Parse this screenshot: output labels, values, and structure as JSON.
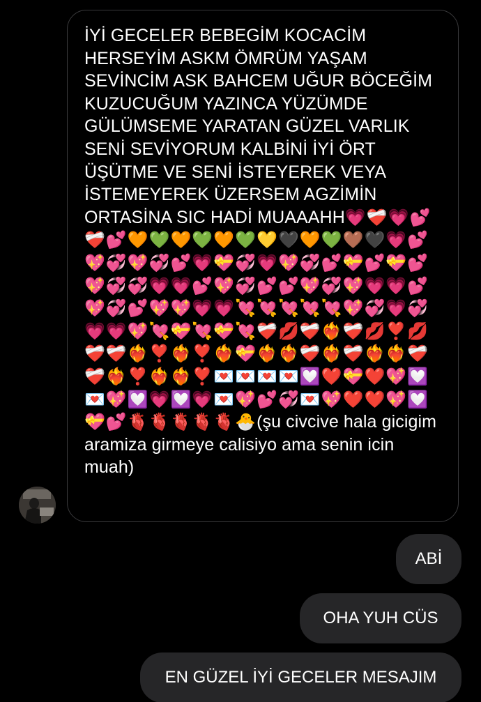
{
  "incoming_message": {
    "text_main": "İYİ GECELER BEBEGİM KOCACİM HERSEYİM ASKM ÖMRÜM YAŞAM SEVİNCİM ASK BAHCEM UĞUR BÖCEĞİM KUZUCUĞUM YAZINCA YÜZÜMDE GÜLÜMSEME YARATAN GÜZEL VARLIK SENİ SEVİYORUM KALBİNİ İYİ ÖRT ÜŞÜTME VE SENİ İSTEYEREK VEYA İSTEMEYEREK ÜZERSEM AGZİMİN ORTASİNA SIC HADİ MUAAAHH",
    "emojis": "💗❤️‍🩹💗💕❤️‍🩹💕🧡💚🧡💚🧡💚💛🖤🧡💚🤎🖤💗💕💖💞💖💞💕💗💝💞💗💖💞💕💝💕💝💕💖💞💞💗💗💕💖💞💕💕💖💞💖💗💗💕💖💞💕💖💖💗💗💘💘💘💘💘💖💞💗💞💗💗💖💘💝💘💝💘❤️‍🩹💋❤️‍🩹❤️‍🔥❤️‍🩹💋❣️💋❤️‍🩹❤️‍🩹❤️‍🔥❣️❤️‍🔥❣️❤️‍🔥💝❤️‍🔥❤️‍🔥❤️‍🩹❤️‍🔥❤️‍🩹❤️‍🔥❤️‍🔥❤️‍🩹❤️‍🩹❤️‍🔥❣️❤️‍🔥❤️‍🔥❣️💌💌💌💌💟❤️💝❤️💖💟💌💖💟💗💟💗💌💖💕💞💌💖❤️❤️💖💟💝💕🫀🫀🫀🫀🫀🐣",
    "text_tail": "(şu civcive hala gicigim aramiza girmeye calisiyo ama senin icin muah)"
  },
  "outgoing_messages": [
    {
      "text": "ABİ"
    },
    {
      "text": "OHA YUH CÜS"
    },
    {
      "text": "EN GÜZEL İYİ GECELER MESAJIM"
    }
  ],
  "avatar_icon": "profile-photo",
  "colors": {
    "background": "#000000",
    "incoming_border": "#3a3a3c",
    "outgoing_bubble": "#262628",
    "text": "#ffffff"
  }
}
